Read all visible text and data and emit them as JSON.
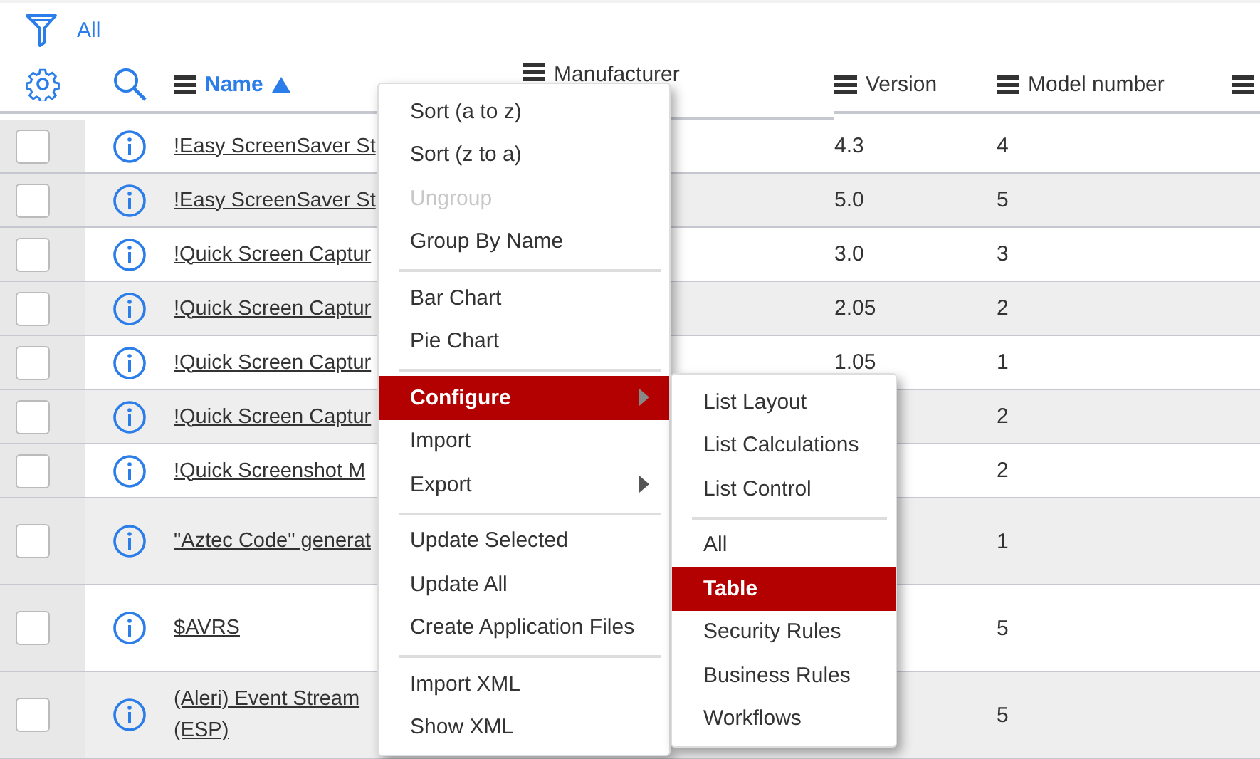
{
  "filter": {
    "label": "All"
  },
  "columns": [
    {
      "label": "Name",
      "sorted": true
    },
    {
      "label": "Manufacturer",
      "sorted": false
    },
    {
      "label": "Version",
      "sorted": false
    },
    {
      "label": "Model number",
      "sorted": false
    }
  ],
  "rows": [
    {
      "name": "!Easy ScreenSaver St",
      "version": "4.3",
      "model": "4",
      "tall": false,
      "checked": false
    },
    {
      "name": "!Easy ScreenSaver St",
      "version": "5.0",
      "model": "5",
      "tall": false,
      "checked": false
    },
    {
      "name": "!Quick Screen Captur",
      "version": "3.0",
      "model": "3",
      "tall": false,
      "checked": false
    },
    {
      "name": "!Quick Screen Captur",
      "version": "2.05",
      "model": "2",
      "tall": false,
      "checked": false
    },
    {
      "name": "!Quick Screen Captur",
      "version": "1.05",
      "model": "1",
      "tall": false,
      "checked": false
    },
    {
      "name": "!Quick Screen Captur",
      "version": "",
      "model": "2",
      "tall": false,
      "checked": false
    },
    {
      "name": "!Quick Screenshot M",
      "version": "",
      "model": "2",
      "tall": false,
      "checked": false
    },
    {
      "name": "\"Aztec Code\" generat",
      "version": "",
      "model": "1",
      "tall": true,
      "checked": false
    },
    {
      "name": "$AVRS",
      "version": "",
      "model": "5",
      "tall": true,
      "checked": false
    },
    {
      "name": "(Aleri) Event Stream (ESP)",
      "version": "",
      "model": "5",
      "tall": true,
      "checked": false
    }
  ],
  "context_menu": [
    {
      "kind": "item",
      "label": "Sort (a to z)",
      "disabled": false,
      "selected": false,
      "submenu": false
    },
    {
      "kind": "item",
      "label": "Sort (z to a)",
      "disabled": false,
      "selected": false,
      "submenu": false
    },
    {
      "kind": "item",
      "label": "Ungroup",
      "disabled": true,
      "selected": false,
      "submenu": false
    },
    {
      "kind": "item",
      "label": "Group By Name",
      "disabled": false,
      "selected": false,
      "submenu": false
    },
    {
      "kind": "divider"
    },
    {
      "kind": "item",
      "label": "Bar Chart",
      "disabled": false,
      "selected": false,
      "submenu": false
    },
    {
      "kind": "item",
      "label": "Pie Chart",
      "disabled": false,
      "selected": false,
      "submenu": false
    },
    {
      "kind": "divider"
    },
    {
      "kind": "item",
      "label": "Configure",
      "disabled": false,
      "selected": true,
      "submenu": true
    },
    {
      "kind": "item",
      "label": "Import",
      "disabled": false,
      "selected": false,
      "submenu": false
    },
    {
      "kind": "item",
      "label": "Export",
      "disabled": false,
      "selected": false,
      "submenu": true
    },
    {
      "kind": "divider"
    },
    {
      "kind": "item",
      "label": "Update Selected",
      "disabled": false,
      "selected": false,
      "submenu": false
    },
    {
      "kind": "item",
      "label": "Update All",
      "disabled": false,
      "selected": false,
      "submenu": false
    },
    {
      "kind": "item",
      "label": "Create Application Files",
      "disabled": false,
      "selected": false,
      "submenu": false
    },
    {
      "kind": "divider"
    },
    {
      "kind": "item",
      "label": "Import XML",
      "disabled": false,
      "selected": false,
      "submenu": false
    },
    {
      "kind": "item",
      "label": "Show XML",
      "disabled": false,
      "selected": false,
      "submenu": false
    }
  ],
  "submenu": [
    {
      "kind": "item",
      "label": "List Layout",
      "disabled": false,
      "selected": false,
      "submenu": false
    },
    {
      "kind": "item",
      "label": "List Calculations",
      "disabled": false,
      "selected": false,
      "submenu": false
    },
    {
      "kind": "item",
      "label": "List Control",
      "disabled": false,
      "selected": false,
      "submenu": false
    },
    {
      "kind": "divider"
    },
    {
      "kind": "item",
      "label": "All",
      "disabled": false,
      "selected": false,
      "submenu": false
    },
    {
      "kind": "item",
      "label": "Table",
      "disabled": false,
      "selected": true,
      "submenu": false
    },
    {
      "kind": "item",
      "label": "Security Rules",
      "disabled": false,
      "selected": false,
      "submenu": false
    },
    {
      "kind": "item",
      "label": "Business Rules",
      "disabled": false,
      "selected": false,
      "submenu": false
    },
    {
      "kind": "item",
      "label": "Workflows",
      "disabled": false,
      "selected": false,
      "submenu": false
    }
  ]
}
